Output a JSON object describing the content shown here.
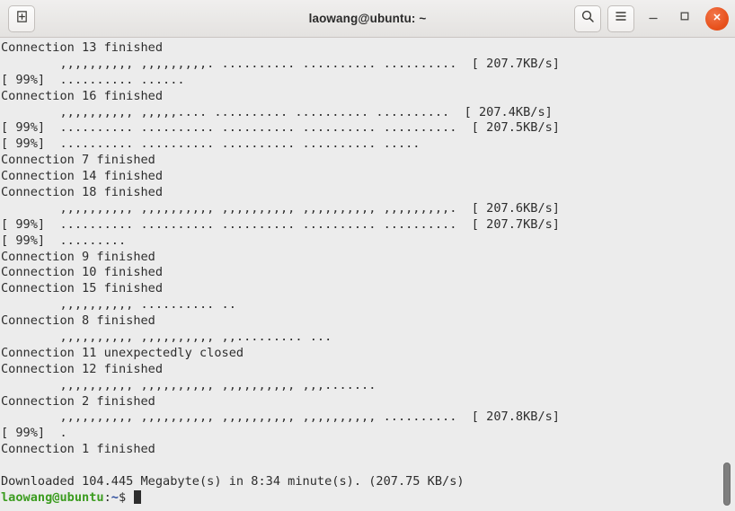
{
  "window": {
    "title": "laowang@ubuntu: ~"
  },
  "titlebar": {
    "new_tab_icon": "new-tab-icon",
    "search_icon": "search-icon",
    "menu_icon": "hamburger-menu-icon",
    "minimize_icon": "minimize-icon",
    "maximize_icon": "maximize-icon",
    "close_icon": "close-icon",
    "accent_color": "#e8521d",
    "bar_background": "#e9e7e5"
  },
  "terminal": {
    "background_color": "#ececec",
    "foreground_color": "#2d2d2d",
    "prompt_user_color": "#3b9c1f",
    "prompt_path_color": "#2b4b9c",
    "lines": [
      "Connection 13 finished",
      "        ,,,,,,,,,, ,,,,,,,,,. .......... .......... ..........  [ 207.7KB/s]",
      "[ 99%]  .......... ......",
      "Connection 16 finished",
      "        ,,,,,,,,,, ,,,,,.... .......... .......... ..........  [ 207.4KB/s]",
      "[ 99%]  .......... .......... .......... .......... ..........  [ 207.5KB/s]",
      "[ 99%]  .......... .......... .......... .......... .....",
      "Connection 7 finished",
      "Connection 14 finished",
      "Connection 18 finished",
      "        ,,,,,,,,,, ,,,,,,,,,, ,,,,,,,,,, ,,,,,,,,,, ,,,,,,,,,.  [ 207.6KB/s]",
      "[ 99%]  .......... .......... .......... .......... ..........  [ 207.7KB/s]",
      "[ 99%]  .........",
      "Connection 9 finished",
      "Connection 10 finished",
      "Connection 15 finished",
      "        ,,,,,,,,,, .......... ..",
      "Connection 8 finished",
      "        ,,,,,,,,,, ,,,,,,,,,, ,,......... ...",
      "Connection 11 unexpectedly closed",
      "Connection 12 finished",
      "        ,,,,,,,,,, ,,,,,,,,,, ,,,,,,,,,, ,,,.......",
      "Connection 2 finished",
      "        ,,,,,,,,,, ,,,,,,,,,, ,,,,,,,,,, ,,,,,,,,,, ..........  [ 207.8KB/s]",
      "[ 99%]  .",
      "Connection 1 finished",
      "",
      "Downloaded 104.445 Megabyte(s) in 8:34 minute(s). (207.75 KB/s)"
    ],
    "prompt": {
      "user_host": "laowang@ubuntu",
      "colon": ":",
      "path": "~",
      "sigil": "$"
    }
  },
  "scrollbar": {
    "thumb_color": "#7e7e7e",
    "position": "bottom"
  }
}
